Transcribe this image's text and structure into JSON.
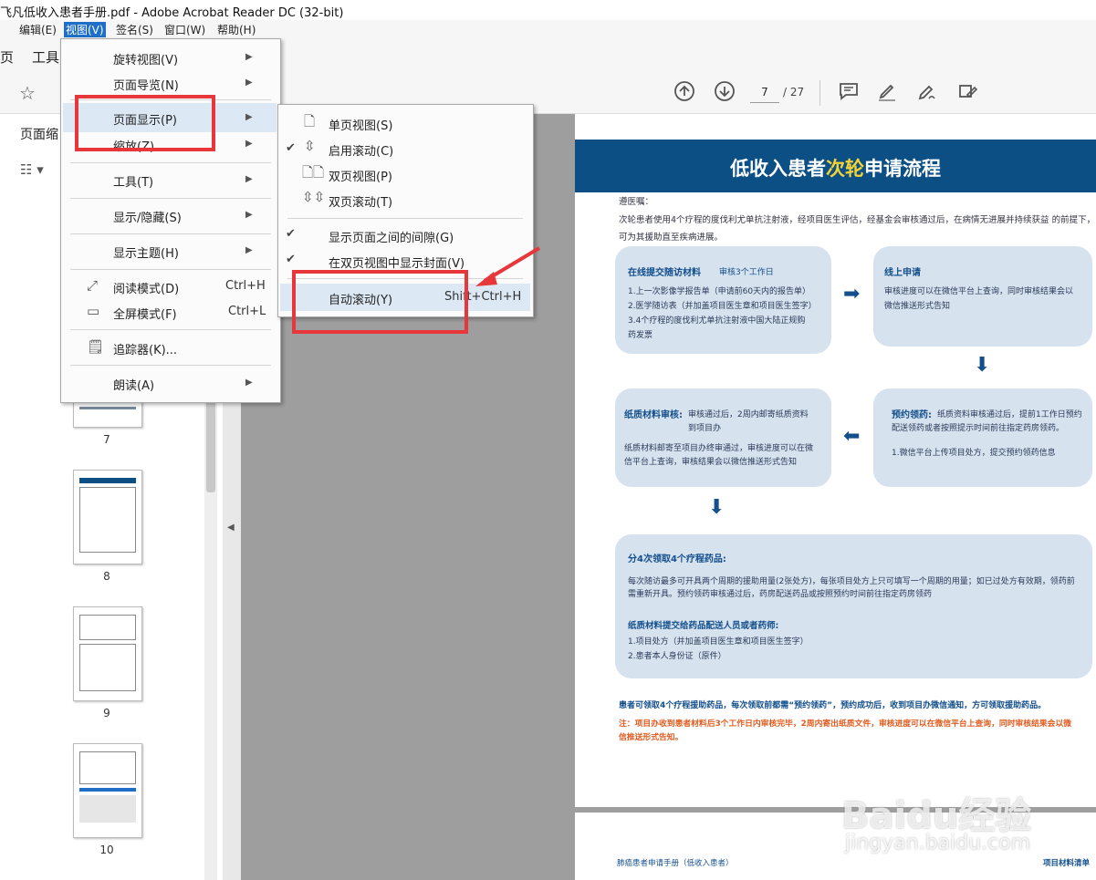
{
  "window": {
    "title": "飞凡低收入患者手册.pdf - Adobe Acrobat Reader DC (32-bit)"
  },
  "menubar": [
    {
      "label": "编辑(E)"
    },
    {
      "label": "视图(V)"
    },
    {
      "label": "签名(S)"
    },
    {
      "label": "窗口(W)"
    },
    {
      "label": "帮助(H)"
    }
  ],
  "tabs": {
    "home_partial": "页",
    "tools": "工具"
  },
  "toolbar": {
    "page_current": "7",
    "page_total": "/ 27"
  },
  "leftpane": {
    "title_partial": "页面缩",
    "thumbnails": [
      {
        "num": "7"
      },
      {
        "num": "8"
      },
      {
        "num": "9"
      },
      {
        "num": "10"
      }
    ]
  },
  "view_menu": {
    "items": [
      {
        "label": "旋转视图(V)"
      },
      {
        "label": "页面导览(N)"
      },
      {
        "label": "页面显示(P)"
      },
      {
        "label": "缩放(Z)"
      },
      {
        "label": "工具(T)"
      },
      {
        "label": "显示/隐藏(S)"
      },
      {
        "label": "显示主题(H)"
      },
      {
        "label": "阅读模式(D)",
        "shortcut": "Ctrl+H"
      },
      {
        "label": "全屏模式(F)",
        "shortcut": "Ctrl+L"
      },
      {
        "label": "追踪器(K)..."
      },
      {
        "label": "朗读(A)"
      }
    ]
  },
  "page_display_menu": {
    "items": [
      {
        "label": "单页视图(S)"
      },
      {
        "label": "启用滚动(C)"
      },
      {
        "label": "双页视图(P)"
      },
      {
        "label": "双页滚动(T)"
      },
      {
        "label": "显示页面之间的间隙(G)"
      },
      {
        "label": "在双页视图中显示封面(V)"
      },
      {
        "label": "自动滚动(Y)",
        "shortcut": "Shift+Ctrl+H"
      }
    ]
  },
  "doc": {
    "title_a": "低收入患者",
    "title_b": "次轮",
    "title_c": "申请流程",
    "intro": [
      "遵医嘱：",
      "次轮患者使用4个疗程的度伐利尤单抗注射液，经项目医生评估，经基金会审核通过后，在病情无进展并持续获益 的前提下，",
      "可为其援助直至疾病进展。"
    ],
    "box1": {
      "title": "在线提交随访材料",
      "sub": "审核3个工作日",
      "lines": [
        "1.上一次影像学报告单（申请前60天内的报告单）",
        "2.医学随访表（并加盖项目医生章和项目医生签字）",
        "3.4个疗程的度伐利尤单抗注射液中国大陆正规购",
        "药发票"
      ]
    },
    "box2": {
      "title": "线上申请",
      "lines": [
        "审核进度可以在微信平台上查询，同时审核结果会以",
        "微信推送形式告知"
      ]
    },
    "box3": {
      "title": "纸质材料审核:",
      "lines": [
        "审核通过后，2周内邮寄纸质资料",
        "到项目办",
        "纸质材料邮寄至项目办终审通过，审核进度可以在微",
        "信平台上查询，审核结果会以微信推送形式告知"
      ]
    },
    "box4": {
      "title": "预约领药:",
      "lines": [
        "纸质资料审核通过后，提前1工作日预约",
        "配送领药或者按照提示时间前往指定药房领药。",
        "1.微信平台上传项目处方，提交预约领药信息"
      ]
    },
    "box5": {
      "title": "分4次领取4个疗程药品:",
      "lines": [
        "每次随访最多可开具两个周期的援助用量(2张处方)，每张项目处方上只可填写一个周期的用量；如已过处方有效期，领药前",
        "需重新开具。预约领药审核通过后，药房配送药品或按照预约时间前往指定药房领药"
      ],
      "title2": "纸质材料提交给药品配送人员或者药师:",
      "lines2": [
        "1.项目处方（并加盖项目医生章和项目医生签字）",
        "2.患者本人身份证（原件）"
      ]
    },
    "note1": "患者可领取4个疗程援助药品，每次领取前都需“预约领药”，预约成功后，收到项目办微信通知，方可领取援助药品。",
    "note2a": "注：项目办收到患者材料后3个工作日内审核完毕，2周内寄出纸质文件，审核进度可以在微信平台上查询，同时审核结果会以微",
    "note2b": "信推送形式告知。",
    "footer_left": "肺癌患者申请手册（低收入患者）",
    "footer_right": "项目材料清单"
  },
  "watermark": {
    "logo": "Baidu经验",
    "url": "jingyan.baidu.com"
  },
  "colors": {
    "accent": "#1f6fc8",
    "banner": "#0b4f85",
    "highlight": "#f5d335",
    "annotation_red": "#e8373b"
  }
}
